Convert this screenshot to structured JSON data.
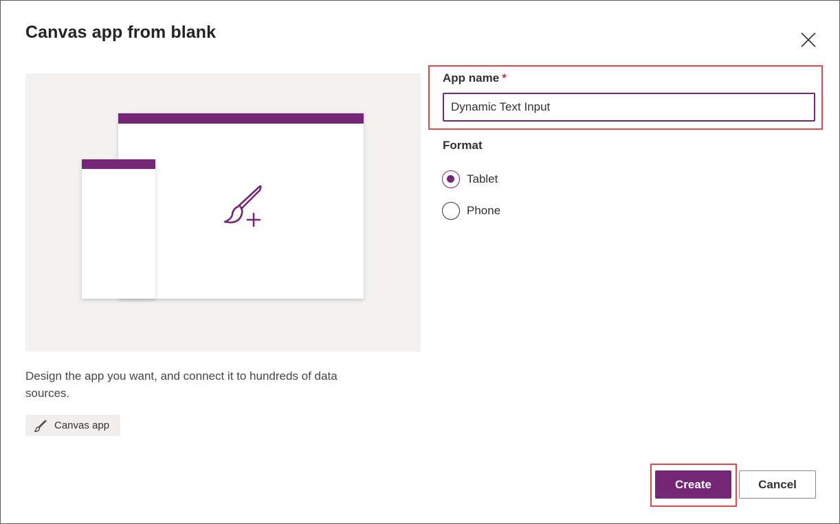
{
  "dialog": {
    "title": "Canvas app from blank",
    "close_icon": "close-icon"
  },
  "preview": {
    "illustration_icon": "paintbrush-plus-icon",
    "accent_color": "#742774",
    "background_color": "#f3f2f1"
  },
  "description": "Design the app you want, and connect it to hundreds of data sources.",
  "tag": {
    "icon": "paintbrush-icon",
    "label": "Canvas app"
  },
  "form": {
    "app_name": {
      "label": "App name",
      "required_marker": "*",
      "value": "Dynamic Text Input"
    },
    "format": {
      "label": "Format",
      "options": [
        {
          "label": "Tablet",
          "checked": true
        },
        {
          "label": "Phone",
          "checked": false
        }
      ]
    }
  },
  "buttons": {
    "create": "Create",
    "cancel": "Cancel"
  },
  "colors": {
    "brand": "#742774",
    "highlight": "#e5464c"
  }
}
